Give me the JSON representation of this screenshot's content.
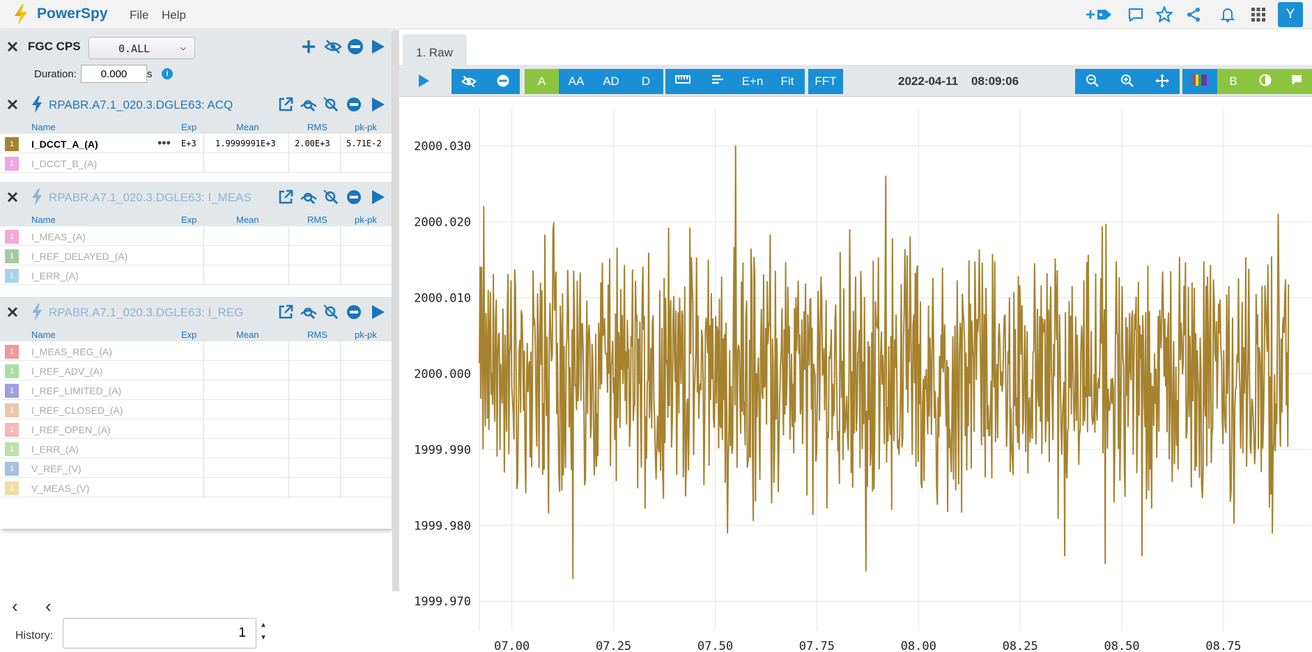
{
  "app": {
    "title": "PowerSpy",
    "menu": [
      "File",
      "Help"
    ]
  },
  "topbar_icons": [
    "add-tag-icon",
    "comment-icon",
    "star-icon",
    "share-icon",
    "bell-icon",
    "apps-grid-icon"
  ],
  "user": {
    "avatar_letter": "Y"
  },
  "cps": {
    "title": "FGC CPS",
    "selector_value": "0.ALL",
    "duration_label": "Duration:",
    "duration_value": "0.000",
    "duration_unit": "s",
    "info_glyph": "i"
  },
  "columns": {
    "name": "Name",
    "exp": "Exp",
    "mean": "Mean",
    "rms": "RMS",
    "pkpk": "pk-pk"
  },
  "groups": [
    {
      "title": "RPABR.A7.1_020.3.DGLE63: ACQ",
      "faded": false,
      "signals": [
        {
          "name": "I_DCCT_A_(A)",
          "color": "#a6822f",
          "index": "1",
          "active": true,
          "exp": "E+3",
          "mean": "1.9999991E+3",
          "rms": "2.00E+3",
          "pkpk": "5.71E-2"
        },
        {
          "name": "I_DCCT_B_(A)",
          "color": "#f0a5e0",
          "index": "1",
          "active": false
        }
      ]
    },
    {
      "title": "RPABR.A7.1_020.3.DGLE63: I_MEAS",
      "faded": true,
      "signals": [
        {
          "name": "I_MEAS_(A)",
          "color": "#f7a7d8",
          "index": "1"
        },
        {
          "name": "I_REF_DELAYED_(A)",
          "color": "#a9c9a4",
          "index": "1"
        },
        {
          "name": "I_ERR_(A)",
          "color": "#a6d3ec",
          "index": "1"
        }
      ]
    },
    {
      "title": "RPABR.A7.1_020.3.DGLE63: I_REG",
      "faded": true,
      "signals": [
        {
          "name": "I_MEAS_REG_(A)",
          "color": "#ef9a9a",
          "index": "1"
        },
        {
          "name": "I_REF_ADV_(A)",
          "color": "#a8dfa0",
          "index": "1"
        },
        {
          "name": "I_REF_LIMITED_(A)",
          "color": "#9f9ee2",
          "index": "1"
        },
        {
          "name": "I_REF_CLOSED_(A)",
          "color": "#eac7a8",
          "index": "1"
        },
        {
          "name": "I_REF_OPEN_(A)",
          "color": "#f7b7b7",
          "index": "1"
        },
        {
          "name": "I_ERR_(A)",
          "color": "#bfe0a6",
          "index": "1"
        },
        {
          "name": "V_REF_(V)",
          "color": "#a9c0e6",
          "index": "1"
        },
        {
          "name": "V_MEAS_(V)",
          "color": "#eedfa6",
          "index": "1"
        }
      ]
    }
  ],
  "history": {
    "label": "History:",
    "value": "1"
  },
  "tab": {
    "label": "1. Raw"
  },
  "toolbar": {
    "modes": [
      "A",
      "AA",
      "AD",
      "D"
    ],
    "tools": [
      "E+n",
      "Fit"
    ],
    "fft": "FFT",
    "b_label": "B",
    "date": "2022-04-11",
    "time": "08:09:06"
  },
  "chart_data": {
    "type": "line",
    "series": [
      {
        "name": "I_DCCT_A_(A)",
        "color": "#a6822f",
        "sample_peaks": [
          {
            "x": 6.925,
            "y": 2000.014
          },
          {
            "x": 6.93,
            "y": 2000.022
          },
          {
            "x": 7.15,
            "y": 1999.973
          },
          {
            "x": 7.55,
            "y": 2000.03
          },
          {
            "x": 7.53,
            "y": 1999.979
          },
          {
            "x": 7.92,
            "y": 2000.026
          },
          {
            "x": 7.87,
            "y": 1999.974
          },
          {
            "x": 8.36,
            "y": 1999.976
          },
          {
            "x": 8.46,
            "y": 1999.975
          },
          {
            "x": 8.55,
            "y": 1999.976
          },
          {
            "x": 8.87,
            "y": 1999.979
          },
          {
            "x": 8.885,
            "y": 2000.021
          }
        ],
        "mean": 2000.0,
        "x_range": [
          6.92,
          8.91
        ],
        "y_range_min": 1999.973,
        "y_range_max": 2000.03
      }
    ],
    "x_ticks": [
      "07.00",
      "07.25",
      "07.50",
      "07.75",
      "08.00",
      "08.25",
      "08.50",
      "08.75"
    ],
    "x_tick_values": [
      7.0,
      7.25,
      7.5,
      7.75,
      8.0,
      8.25,
      8.5,
      8.75
    ],
    "y_ticks": [
      "2000.030",
      "2000.020",
      "2000.010",
      "2000.000",
      "1999.990",
      "1999.980",
      "1999.970"
    ],
    "y_tick_values": [
      2000.03,
      2000.02,
      2000.01,
      2000.0,
      1999.99,
      1999.98,
      1999.97
    ],
    "xlim": [
      6.92,
      8.93
    ],
    "ylim": [
      1999.968,
      2000.035
    ],
    "grid": true
  }
}
